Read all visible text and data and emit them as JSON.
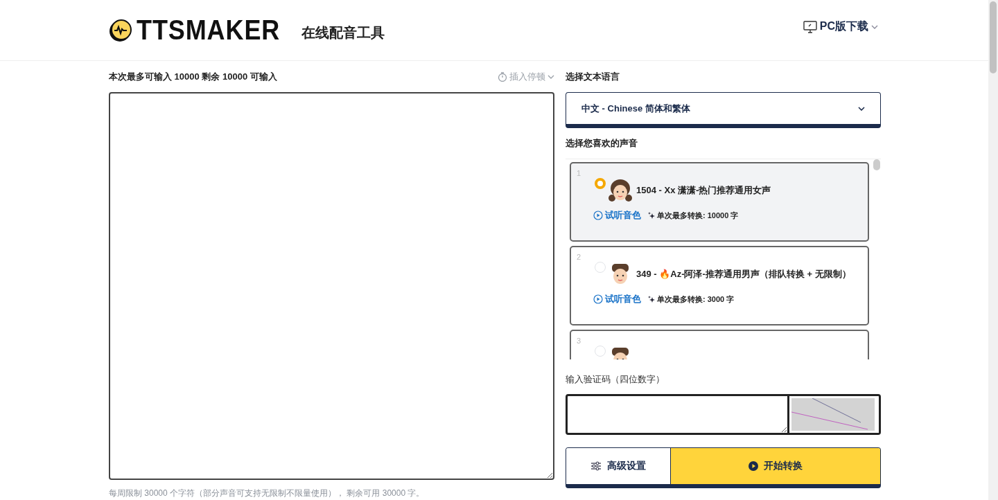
{
  "header": {
    "logo_text": "TTSMAKER",
    "subtitle": "在线配音工具",
    "download": "PC版下载"
  },
  "editor": {
    "limit_text": "本次最多可输入 10000 剩余 10000 可输入",
    "pause_button": "插入停顿",
    "footer": "每周限制 30000 个字符（部分声音可支持无限制不限量使用）， 剩余可用 30000 字。"
  },
  "language": {
    "label": "选择文本语言",
    "value": "中文 - Chinese 简体和繁体"
  },
  "voices": {
    "label": "选择您喜欢的声音",
    "items": [
      {
        "index": "1",
        "kind": "female",
        "selected": true,
        "name": "1504 - Xx 潇潇-热门推荐通用女声",
        "preview": "试听音色",
        "limit": "单次最多转换: 10000 字"
      },
      {
        "index": "2",
        "kind": "male",
        "selected": false,
        "name": "349 - 🔥Az-阿泽-推荐通用男声（排队转换 + 无限制）",
        "preview": "试听音色",
        "limit": "单次最多转换: 3000 字"
      },
      {
        "index": "3",
        "kind": "male",
        "selected": false
      }
    ]
  },
  "captcha": {
    "label": "输入验证码（四位数字）"
  },
  "buttons": [
    {
      "label": "高级设置",
      "kind": "settings"
    },
    {
      "label": "开始转换",
      "kind": "primary"
    }
  ]
}
